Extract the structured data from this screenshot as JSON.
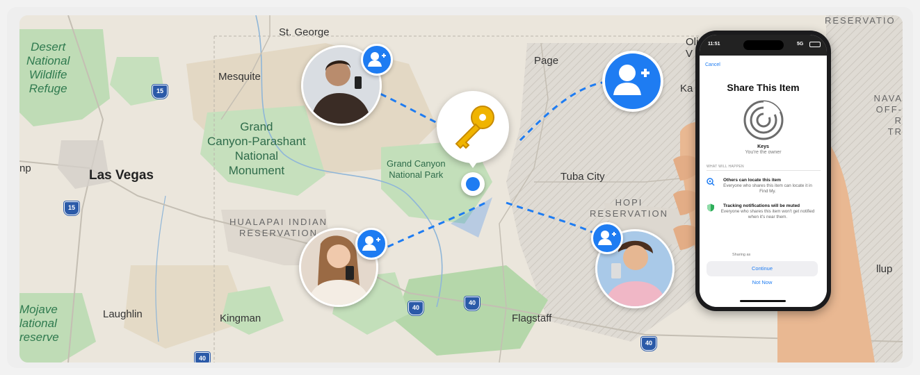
{
  "map": {
    "labels": {
      "desert": "Desert\nNational\nWildlife\nRefuge",
      "st_george": "St. George",
      "mesquite": "Mesquite",
      "grand_canyon_parashant": "Grand\nCanyon-Parashant\nNational\nMonument",
      "las_vegas": "Las Vegas",
      "np": "np",
      "grand_canyon_np": "Grand Canyon\nNational Park",
      "page": "Page",
      "oljato": "Olja\nV",
      "kayenta": "Ka",
      "tuba_city": "Tuba City",
      "hopi": "HOPI\nRESERVATION",
      "hualapai": "HUALAPAI INDIAN\nRESERVATION",
      "reservation_top": "RESERVATIO",
      "navajo": "NAVA\nOFF-R\nTR",
      "gallup": "llup",
      "mojave": "Mojave\nlational\nreserve",
      "laughlin": "Laughlin",
      "kingman": "Kingman",
      "flagstaff": "Flagstaff"
    },
    "highways": {
      "i15_north": "15",
      "i15_south": "15",
      "i40_a": "40",
      "i40_b": "40",
      "i40_c": "40",
      "i40_d": "40"
    }
  },
  "phone": {
    "status": {
      "time": "11:51",
      "signal": "5G"
    },
    "sheet": {
      "cancel_label": "Cancel",
      "title": "Share This Item",
      "item_name": "Keys",
      "owner_text": "You're the owner",
      "section_header": "WHAT WILL HAPPEN",
      "rows": [
        {
          "title": "Others can locate this item",
          "body": "Everyone who shares this item can locate it in Find My."
        },
        {
          "title": "Tracking notifications will be muted",
          "body": "Everyone who shares this item won't get notified when it's near them."
        }
      ],
      "sharing_as_label": "Sharing as",
      "continue_label": "Continue",
      "not_now_label": "Not Now"
    }
  },
  "colors": {
    "accent": "#1e7cf2",
    "park_green": "#b8d8b0",
    "land": "#ebe6dc",
    "reservation_hatch": "#d6d2cb"
  },
  "icons": {
    "pin": "key-icon",
    "badge": "add-person-icon",
    "radar": "radar-icon",
    "locate": "locate-icon",
    "shield": "shield-icon"
  }
}
